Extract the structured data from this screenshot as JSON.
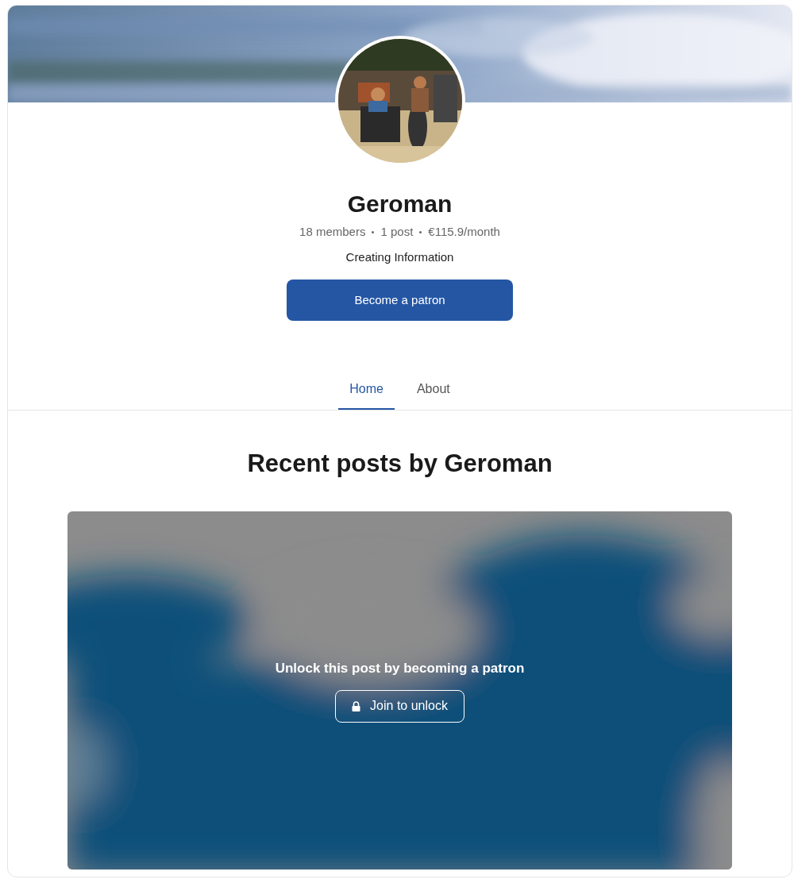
{
  "creator": {
    "name": "Geroman",
    "stats": [
      "18 members",
      "1 post",
      "€115.9/month"
    ],
    "tagline": "Creating Information",
    "cta": "Become a patron"
  },
  "tabs": [
    {
      "label": "Home",
      "selected": true
    },
    {
      "label": "About",
      "selected": false
    }
  ],
  "posts": {
    "heading": "Recent posts by Geroman",
    "locked_post": {
      "message": "Unlock this post by becoming a patron",
      "button": "Join to unlock"
    }
  }
}
